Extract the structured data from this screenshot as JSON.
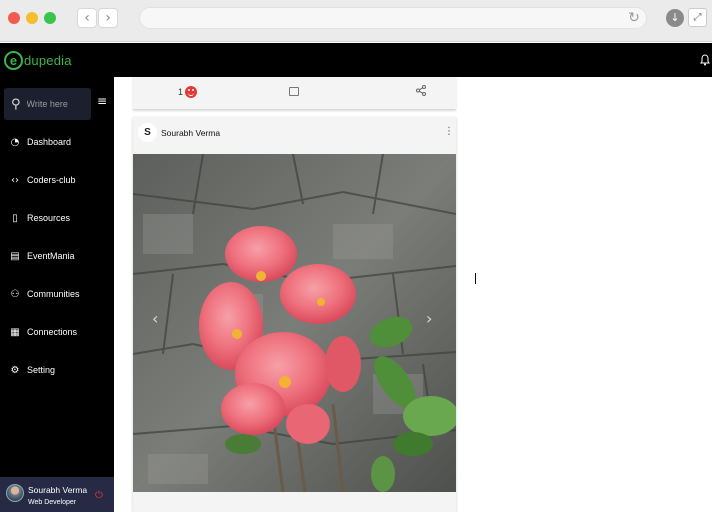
{
  "browser": {
    "back_icon": "chevron-left-icon",
    "forward_icon": "chevron-right-icon",
    "reload_icon": "reload-icon",
    "download_icon": "download-icon",
    "expand_icon": "expand-icon",
    "window_colors": [
      "#f25a4f",
      "#f5be2e",
      "#39c54a"
    ]
  },
  "topbar": {
    "logo_letter": "e",
    "logo_text": "dupedia",
    "brand_color": "#3cb54a",
    "notification_icon": "bell-icon"
  },
  "sidebar": {
    "search_placeholder": "Write here",
    "items": [
      {
        "label": "Dashboard",
        "icon": "dashboard-icon"
      },
      {
        "label": "Coders-club",
        "icon": "code-icon"
      },
      {
        "label": "Resources",
        "icon": "resources-icon"
      },
      {
        "label": "EventMania",
        "icon": "event-icon"
      },
      {
        "label": "Communities",
        "icon": "communities-icon"
      },
      {
        "label": "Connections",
        "icon": "connections-icon"
      },
      {
        "label": "Setting",
        "icon": "gear-icon"
      }
    ],
    "profile": {
      "name": "Sourabh Verma",
      "role": "Web Developer",
      "logout_color": "#e53935"
    }
  },
  "feed": {
    "actions": {
      "reaction_count": "1",
      "reaction_icon": "smiley-icon",
      "comment_icon": "comment-icon",
      "share_icon": "share-icon"
    },
    "post": {
      "author_initial": "S",
      "author_name": "Sourabh Verma",
      "image": "photo of red crown-of-thorns flowers in front of a grey stone wall"
    }
  }
}
